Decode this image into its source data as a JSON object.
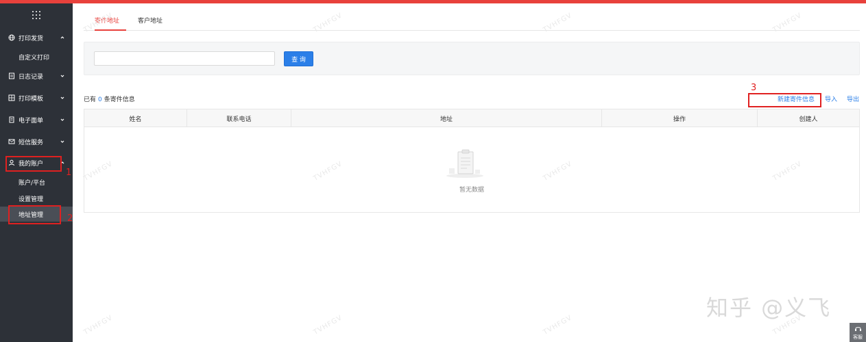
{
  "sidebar": {
    "items": [
      {
        "label": "打印发货",
        "icon": "globe-icon",
        "expanded": true
      },
      {
        "label": "日志记录",
        "icon": "document-icon",
        "expanded": false
      },
      {
        "label": "打印模板",
        "icon": "template-icon",
        "expanded": false
      },
      {
        "label": "电子面单",
        "icon": "receipt-icon",
        "expanded": false
      },
      {
        "label": "短信服务",
        "icon": "mail-icon",
        "expanded": false
      },
      {
        "label": "我的账户",
        "icon": "user-icon",
        "expanded": true
      }
    ],
    "sub_print": [
      "自定义打印"
    ],
    "sub_account": [
      "账户/平台",
      "设置管理",
      "地址管理"
    ]
  },
  "annotations": [
    "1",
    "2",
    "3"
  ],
  "tabs": [
    "寄件地址",
    "客户地址"
  ],
  "search": {
    "value": "",
    "placeholder": "",
    "button_label": "查 询"
  },
  "summary": {
    "prefix": "已有",
    "count": "0",
    "suffix": "条寄件信息"
  },
  "actions": {
    "new": "新建寄件信息",
    "import": "导入",
    "export": "导出"
  },
  "table": {
    "columns": [
      "姓名",
      "联系电话",
      "地址",
      "操作",
      "创建人"
    ],
    "empty_text": "暂无数据"
  },
  "watermark": "TVHFGV",
  "brand_watermark": "知乎 @义飞",
  "service_label": "客服",
  "colors": {
    "accent": "#e8413c",
    "primary": "#2b7fe8",
    "sidebar": "#2d3138"
  }
}
